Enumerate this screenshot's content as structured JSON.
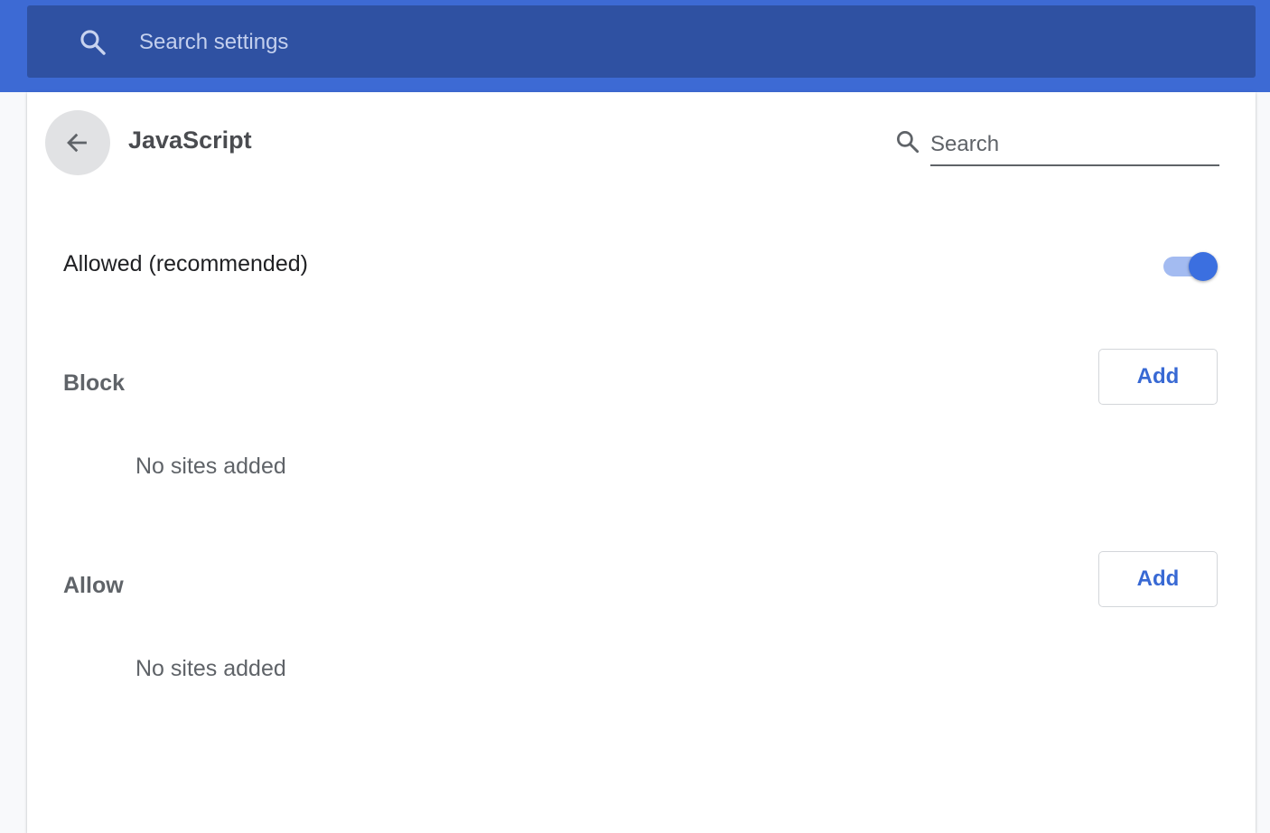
{
  "header": {
    "search_placeholder": "Search settings",
    "search_icon": "search-icon"
  },
  "page": {
    "title": "JavaScript",
    "back_icon": "arrow-back-icon",
    "search_placeholder": "Search",
    "search_icon": "search-icon"
  },
  "setting": {
    "label": "Allowed (recommended)",
    "enabled": true
  },
  "sections": [
    {
      "title": "Block",
      "add_label": "Add",
      "empty_text": "No sites added"
    },
    {
      "title": "Allow",
      "add_label": "Add",
      "empty_text": "No sites added"
    }
  ],
  "colors": {
    "header_bg": "#3d6ad4",
    "search_bg": "#2f51a2",
    "accent": "#3869d4",
    "toggle_track": "#a3bbf1",
    "toggle_knob": "#3b6fe0"
  }
}
